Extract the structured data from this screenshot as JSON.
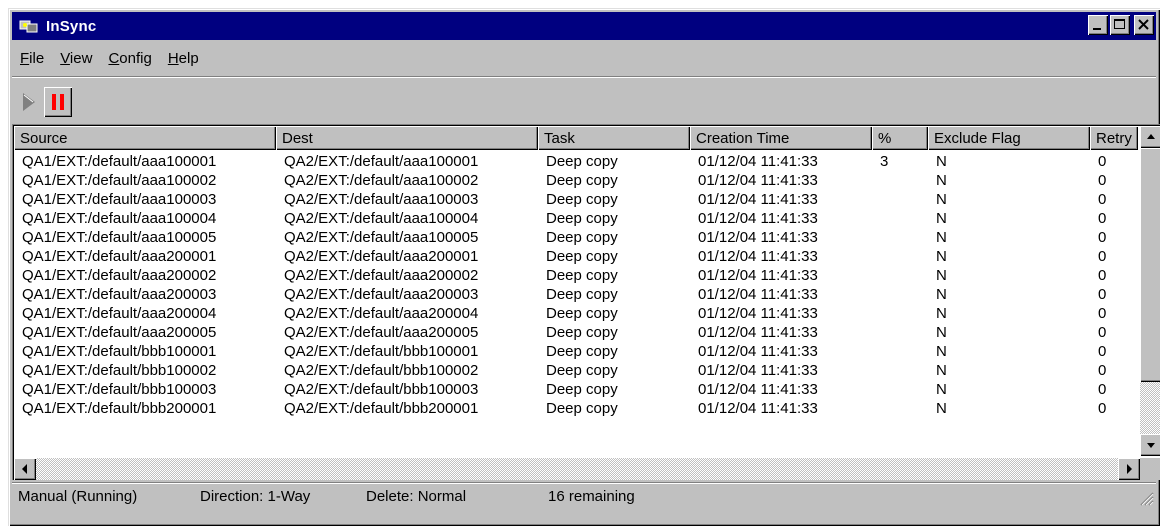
{
  "window": {
    "title": "InSync"
  },
  "menu": [
    {
      "underline": "F",
      "rest": "ile"
    },
    {
      "underline": "V",
      "rest": "iew"
    },
    {
      "underline": "C",
      "rest": "onfig"
    },
    {
      "underline": "H",
      "rest": "elp"
    }
  ],
  "toolbar": {
    "play_icon": "play-icon",
    "pause_icon": "pause-icon",
    "pause_color": "#ff0000"
  },
  "table": {
    "columns": [
      "Source",
      "Dest",
      "Task",
      "Creation Time",
      "%",
      "Exclude Flag",
      "Retry"
    ],
    "rows": [
      [
        "QA1/EXT:/default/aaa100001",
        "QA2/EXT:/default/aaa100001",
        "Deep copy",
        "01/12/04 11:41:33",
        "3",
        "N",
        "0"
      ],
      [
        "QA1/EXT:/default/aaa100002",
        "QA2/EXT:/default/aaa100002",
        "Deep copy",
        "01/12/04 11:41:33",
        "",
        "N",
        "0"
      ],
      [
        "QA1/EXT:/default/aaa100003",
        "QA2/EXT:/default/aaa100003",
        "Deep copy",
        "01/12/04 11:41:33",
        "",
        "N",
        "0"
      ],
      [
        "QA1/EXT:/default/aaa100004",
        "QA2/EXT:/default/aaa100004",
        "Deep copy",
        "01/12/04 11:41:33",
        "",
        "N",
        "0"
      ],
      [
        "QA1/EXT:/default/aaa100005",
        "QA2/EXT:/default/aaa100005",
        "Deep copy",
        "01/12/04 11:41:33",
        "",
        "N",
        "0"
      ],
      [
        "QA1/EXT:/default/aaa200001",
        "QA2/EXT:/default/aaa200001",
        "Deep copy",
        "01/12/04 11:41:33",
        "",
        "N",
        "0"
      ],
      [
        "QA1/EXT:/default/aaa200002",
        "QA2/EXT:/default/aaa200002",
        "Deep copy",
        "01/12/04 11:41:33",
        "",
        "N",
        "0"
      ],
      [
        "QA1/EXT:/default/aaa200003",
        "QA2/EXT:/default/aaa200003",
        "Deep copy",
        "01/12/04 11:41:33",
        "",
        "N",
        "0"
      ],
      [
        "QA1/EXT:/default/aaa200004",
        "QA2/EXT:/default/aaa200004",
        "Deep copy",
        "01/12/04 11:41:33",
        "",
        "N",
        "0"
      ],
      [
        "QA1/EXT:/default/aaa200005",
        "QA2/EXT:/default/aaa200005",
        "Deep copy",
        "01/12/04 11:41:33",
        "",
        "N",
        "0"
      ],
      [
        "QA1/EXT:/default/bbb100001",
        "QA2/EXT:/default/bbb100001",
        "Deep copy",
        "01/12/04 11:41:33",
        "",
        "N",
        "0"
      ],
      [
        "QA1/EXT:/default/bbb100002",
        "QA2/EXT:/default/bbb100002",
        "Deep copy",
        "01/12/04 11:41:33",
        "",
        "N",
        "0"
      ],
      [
        "QA1/EXT:/default/bbb100003",
        "QA2/EXT:/default/bbb100003",
        "Deep copy",
        "01/12/04 11:41:33",
        "",
        "N",
        "0"
      ],
      [
        "QA1/EXT:/default/bbb200001",
        "QA2/EXT:/default/bbb200001",
        "Deep copy",
        "01/12/04 11:41:33",
        "",
        "N",
        "0"
      ]
    ]
  },
  "status": {
    "mode": "Manual (Running)",
    "direction": "Direction: 1-Way",
    "delete": "Delete: Normal",
    "remaining": "16 remaining"
  }
}
